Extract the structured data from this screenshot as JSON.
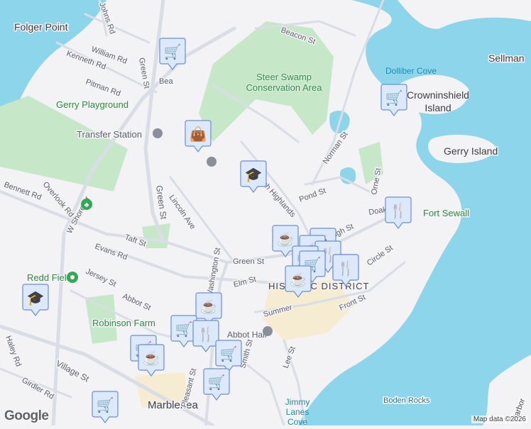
{
  "map": {
    "attribution": "Map data ©2026",
    "logo": "Google",
    "colors": {
      "water": "#8dd5ea",
      "park": "#c6e8c8",
      "land": "#f3f2f4",
      "road": "#d9dde6",
      "downtown": "#f6ecd2",
      "marker_fill": "#dce8fb",
      "marker_border": "#6a8fd6",
      "icon": "#0d4a72"
    },
    "labels": {
      "folger_point": "Folger Point",
      "johns_rd": "Johns Rd",
      "william_rd": "William Rd",
      "kenneth_rd": "Kenneth Rd",
      "pitman_rd": "Pitman Rd",
      "gerry_playground": "Gerry Playground",
      "transfer_station": "Transfer Station",
      "w_shore_dr": "W Shore Dr",
      "green_st_n": "Green St",
      "green_st": "Green St",
      "bennett_rd": "Bennett Rd",
      "overlook_rd": "Overlook Rd",
      "lincoln_ave": "Lincoln Ave",
      "taft_st": "Taft St",
      "evans_rd": "Evans Rd",
      "jersey_st": "Jersey St",
      "redd_field": "Redd Field",
      "abbot_st": "Abbot St",
      "robinson_farm": "Robinson Farm",
      "haley_rd": "Haley Rd",
      "village_st": "Village St",
      "girdler_rd": "Girdler Rd",
      "marblehead": "Marblehea",
      "beacon_st": "Beacon St",
      "steer_swamp": "Steer Swamp Conservation Area",
      "norman_st": "Norman St",
      "peach_highlands": "Peach Highlands",
      "pond_st": "Pond St",
      "green_st_e": "Green St",
      "elm_st": "Elm St",
      "high_st": "High St",
      "doaks_ln": "Doaks Ln",
      "orne_st": "Orne St",
      "circle_st": "Circle St",
      "front_st": "Front St",
      "summer": "Summer",
      "historic": "HISTORIC DISTRICT",
      "abbot_hall": "Abbot Hall",
      "lee_st": "Lee St",
      "pleasant_st": "Pleasant St",
      "washington_st": "Washington St",
      "smith_st": "Smith St",
      "dolliber_cove": "Dolliber Cove",
      "sellman": "Sellman",
      "crowninshield": "Crowninshield Island",
      "gerry_island": "Gerry Island",
      "fort_sewall": "Fort Sewall",
      "jimmy_lanes_cove": "Jimmy Lanes Cove",
      "boden_rocks": "Boden Rocks",
      "harbor": "Harbor",
      "beacon_short": "Bea"
    },
    "markers": [
      {
        "icon": "cart-icon",
        "label": "grocery"
      },
      {
        "icon": "cart-icon",
        "label": "grocery"
      },
      {
        "icon": "bag-icon",
        "label": "shopping"
      },
      {
        "icon": "school-icon",
        "label": "school"
      },
      {
        "icon": "fork-knife-icon",
        "label": "restaurant"
      },
      {
        "icon": "cup-icon",
        "label": "cafe"
      },
      {
        "icon": "cup-icon",
        "label": "cafe"
      },
      {
        "icon": "cup-icon",
        "label": "cafe"
      },
      {
        "icon": "fork-knife-icon",
        "label": "restaurant"
      },
      {
        "icon": "cart-icon",
        "label": "grocery"
      },
      {
        "icon": "cart-icon",
        "label": "grocery"
      },
      {
        "icon": "fork-knife-icon",
        "label": "restaurant"
      },
      {
        "icon": "fork-knife-icon",
        "label": "restaurant"
      },
      {
        "icon": "cup-icon",
        "label": "cafe"
      },
      {
        "icon": "cup-icon",
        "label": "cafe"
      },
      {
        "icon": "cart-icon",
        "label": "grocery"
      },
      {
        "icon": "fork-knife-icon",
        "label": "restaurant"
      },
      {
        "icon": "cart-icon",
        "label": "grocery"
      },
      {
        "icon": "cup-icon",
        "label": "cafe"
      },
      {
        "icon": "cart-icon",
        "label": "grocery"
      },
      {
        "icon": "cart-icon",
        "label": "grocery"
      },
      {
        "icon": "cart-icon",
        "label": "grocery"
      },
      {
        "icon": "school-icon",
        "label": "school"
      }
    ]
  }
}
